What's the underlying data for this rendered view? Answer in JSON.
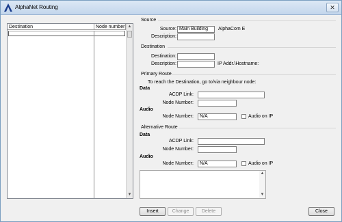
{
  "window": {
    "title": "AlphaNet Routing"
  },
  "table": {
    "columns": [
      "Destination",
      "Node number"
    ]
  },
  "source": {
    "group_title": "Source",
    "source_label": "Source:",
    "source_value": "Main Building",
    "source_suffix": "AlphaCom E",
    "description_label": "Description:",
    "description_value": ""
  },
  "destination": {
    "group_title": "Destination",
    "destination_label": "Destination:",
    "destination_value": "",
    "description_label": "Description:",
    "description_value": "",
    "ip_label": "IP Addr.\\Hostname:"
  },
  "primary_route": {
    "group_title": "Primary Route",
    "instruction": "To reach the Destination, go to/via neighbour node:",
    "data_heading": "Data",
    "acdp_label": "ACDP Link:",
    "acdp_value": "",
    "node_label": "Node Number:",
    "node_value": "",
    "audio_heading": "Audio",
    "audio_node_label": "Node Number:",
    "audio_node_value": "N/A",
    "audio_on_ip_label": "Audio on IP",
    "audio_on_ip_checked": false
  },
  "alternative_route": {
    "group_title": "Alternative Route",
    "data_heading": "Data",
    "acdp_label": "ACDP Link:",
    "acdp_value": "",
    "node_label": "Node Number:",
    "node_value": "",
    "audio_heading": "Audio",
    "audio_node_label": "Node Number:",
    "audio_node_value": "N/A",
    "audio_on_ip_label": "Audio on IP",
    "audio_on_ip_checked": false
  },
  "buttons": {
    "insert": "Insert",
    "change": "Change",
    "delete": "Delete",
    "close": "Close"
  }
}
